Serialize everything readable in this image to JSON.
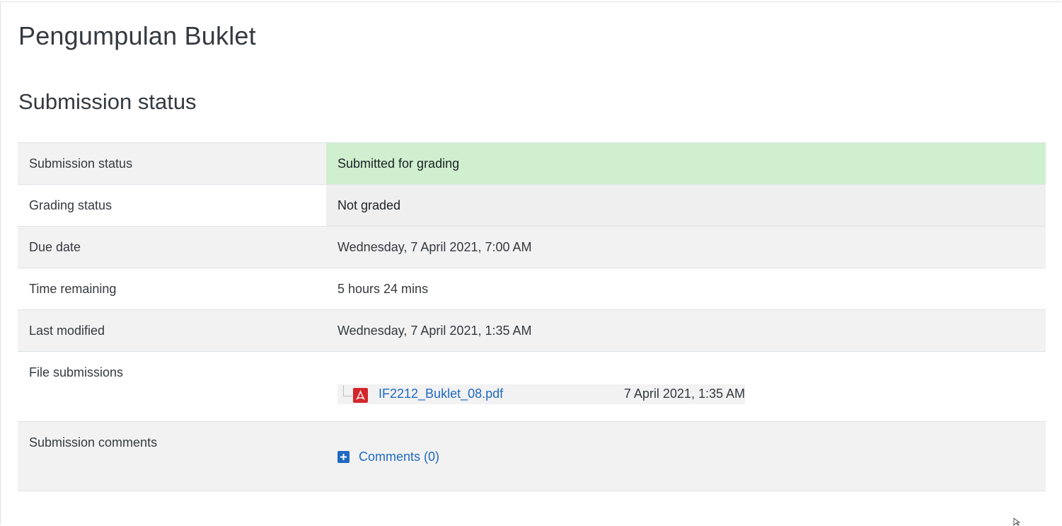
{
  "page": {
    "title": "Pengumpulan Buklet",
    "section_title": "Submission status"
  },
  "rows": {
    "submission_status": {
      "label": "Submission status",
      "value": "Submitted for grading"
    },
    "grading_status": {
      "label": "Grading status",
      "value": "Not graded"
    },
    "due_date": {
      "label": "Due date",
      "value": "Wednesday, 7 April 2021, 7:00 AM"
    },
    "time_remaining": {
      "label": "Time remaining",
      "value": "5 hours 24 mins"
    },
    "last_modified": {
      "label": "Last modified",
      "value": "Wednesday, 7 April 2021, 1:35 AM"
    },
    "file_submissions": {
      "label": "File submissions",
      "file": {
        "name": "IF2212_Buklet_08.pdf",
        "date": "7 April 2021, 1:35 AM",
        "icon": "pdf-file-icon"
      }
    },
    "submission_comments": {
      "label": "Submission comments",
      "link": "Comments (0)",
      "icon": "plus-square-icon"
    }
  },
  "colors": {
    "submitted_bg": "#cfefcf",
    "link": "#1f69c1",
    "stripe": "#f2f2f2",
    "pdf_red": "#d3262a"
  }
}
